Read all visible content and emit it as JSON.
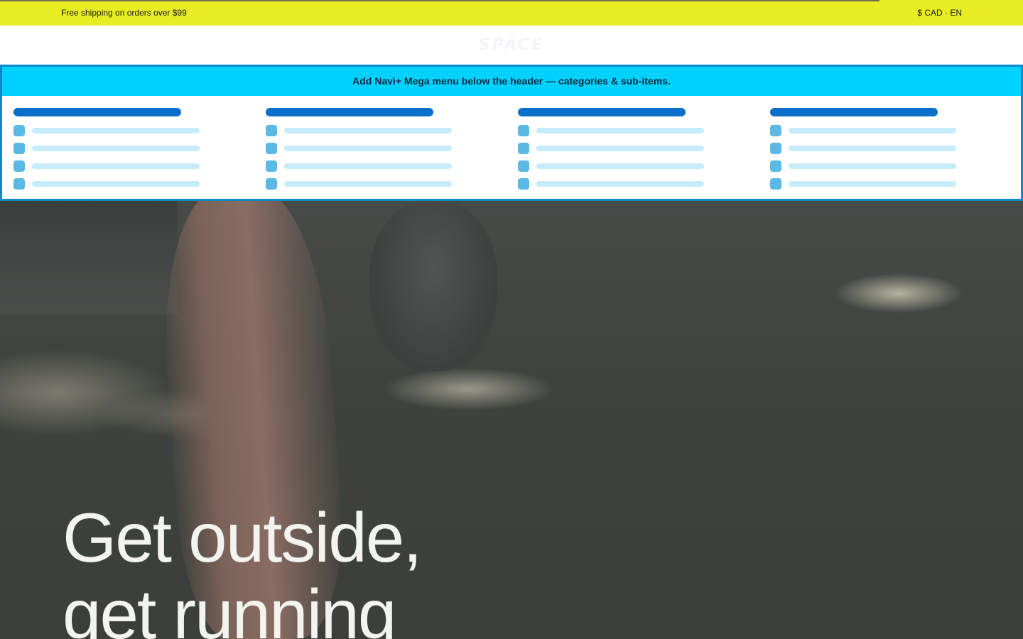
{
  "announcement": {
    "message": "Free shipping on orders over $99",
    "locale": "$ CAD · EN"
  },
  "header": {
    "logo_text": "SPACE"
  },
  "mega_menu": {
    "banner": "Add Navi+ Mega menu below the header — categories & sub-items.",
    "columns": [
      {
        "items": 4
      },
      {
        "items": 4
      },
      {
        "items": 4
      },
      {
        "items": 4
      }
    ]
  },
  "hero": {
    "headline_line1": "Get outside,",
    "headline_line2": "get running"
  },
  "colors": {
    "announcement_bg": "#e8ec22",
    "mega_banner_bg": "#00d1ff",
    "mega_border": "#0a8ac9",
    "placeholder_title": "#0a6fc8",
    "placeholder_icon": "#5bb9e6",
    "placeholder_bar": "#c6ecfa"
  }
}
